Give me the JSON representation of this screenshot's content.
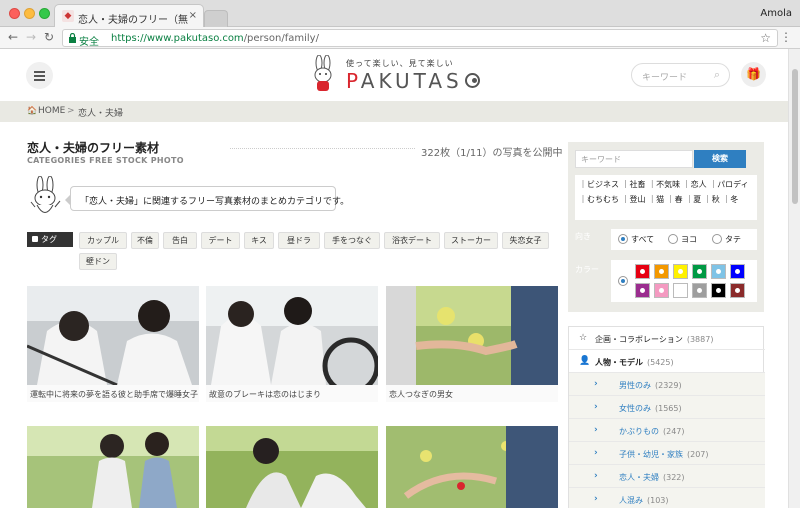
{
  "browser": {
    "tab_title": "恋人・夫婦のフリー（無料）写",
    "tab_close": "×",
    "profile_name": "Amola",
    "secure_label": "安全",
    "url_host": "https://www.pakutaso.com",
    "url_path": "/person/family/",
    "icons": {
      "back": "←",
      "forward": "→",
      "reload": "↻",
      "star": "☆",
      "menu": "⋮"
    }
  },
  "header": {
    "tagline": "使って楽しい、見て楽しい",
    "logo_p": "P",
    "logo_rest": "AKUTAS",
    "search_placeholder": "キーワード",
    "search_icon": "⌕",
    "gift_icon": "🎁"
  },
  "breadcrumb": {
    "home_icon": "🏠",
    "home": "HOME",
    "sep": ">",
    "current": "恋人・夫婦"
  },
  "main": {
    "title": "恋人・夫婦のフリー素材",
    "subtitle": "CATEGORIES FREE STOCK PHOTO",
    "count": "322枚（1/11）の写真を公開中",
    "description": "「恋人・夫婦」に関連するフリー写真素材のまとめカテゴリです。",
    "tag_label": "タグ",
    "tags": [
      "カップル",
      "不倫",
      "告白",
      "デート",
      "キス",
      "昼ドラ",
      "手をつなぐ",
      "浴衣デート",
      "ストーカー",
      "失恋女子",
      "壁ドン"
    ],
    "photos": [
      {
        "caption": "運転中に将来の夢を語る彼と助手席で爆睡女子"
      },
      {
        "caption": "故意のブレーキは恋のはじまり"
      },
      {
        "caption": "恋人つなぎの男女"
      },
      {
        "caption": ""
      },
      {
        "caption": ""
      },
      {
        "caption": ""
      }
    ]
  },
  "sidebar": {
    "search_placeholder": "キーワード",
    "search_button": "検索",
    "categories_line1": [
      "ビジネス",
      "社畜",
      "不気味",
      "恋人",
      "パロディ"
    ],
    "categories_line2": [
      "むちむち",
      "登山",
      "猫",
      "春",
      "夏",
      "秋",
      "冬"
    ],
    "cat_sep": "｜",
    "direction_label": "向き",
    "directions": [
      "すべて",
      "ヨコ",
      "タテ"
    ],
    "color_label": "カラー",
    "colors": [
      "#e60012",
      "#f39800",
      "#fff100",
      "#009944",
      "#7fc3e6",
      "#0000ff",
      "#9b2d8f",
      "#f49ac1",
      "#ffffff",
      "#9e9e9e",
      "#000000",
      "#8b2b2b"
    ],
    "menu": [
      {
        "icon": "☆",
        "label": "企画・コラボレーション",
        "count": "(3887)",
        "sub": false
      },
      {
        "icon": "👤",
        "label": "人物・モデル",
        "count": "(5425)",
        "sub": false
      },
      {
        "icon": "›",
        "label": "男性のみ",
        "count": "(2329)",
        "sub": true
      },
      {
        "icon": "›",
        "label": "女性のみ",
        "count": "(1565)",
        "sub": true
      },
      {
        "icon": "›",
        "label": "かぶりもの",
        "count": "(247)",
        "sub": true
      },
      {
        "icon": "›",
        "label": "子供・幼児・家族",
        "count": "(207)",
        "sub": true
      },
      {
        "icon": "›",
        "label": "恋人・夫婦",
        "count": "(322)",
        "sub": true
      },
      {
        "icon": "›",
        "label": "人混み",
        "count": "(103)",
        "sub": true
      }
    ]
  }
}
